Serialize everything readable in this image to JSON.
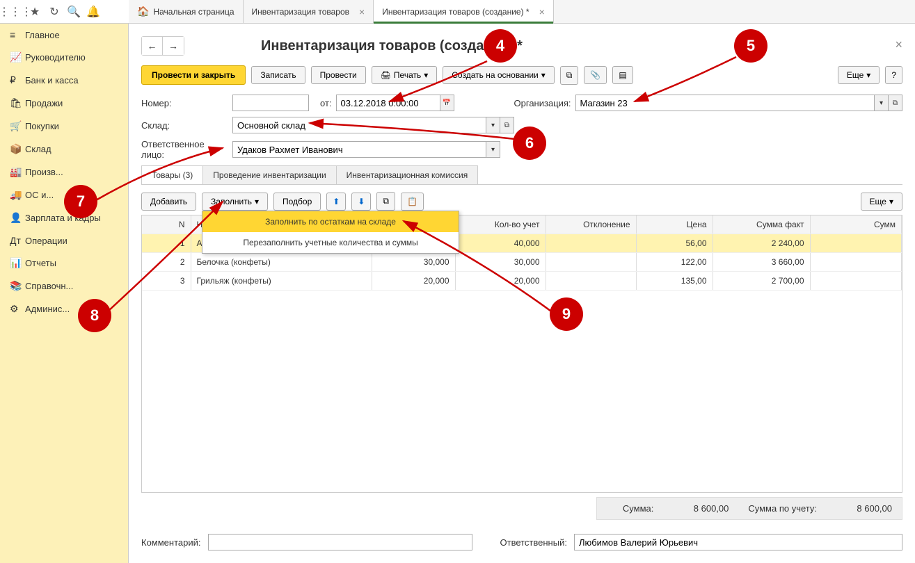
{
  "tabs": {
    "home": "Начальная страница",
    "t1": "Инвентаризация товаров",
    "t2": "Инвентаризация товаров (создание) *"
  },
  "sidebar": {
    "items": [
      {
        "icon": "≡",
        "label": "Главное"
      },
      {
        "icon": "📈",
        "label": "Руководителю"
      },
      {
        "icon": "₽",
        "label": "Банк и касса"
      },
      {
        "icon": "🛍",
        "label": "Продажи"
      },
      {
        "icon": "🛒",
        "label": "Покупки"
      },
      {
        "icon": "📦",
        "label": "Склад"
      },
      {
        "icon": "🏭",
        "label": "Произв..."
      },
      {
        "icon": "🚚",
        "label": "ОС и..."
      },
      {
        "icon": "👤",
        "label": "Зарплата и кадры"
      },
      {
        "icon": "Дт",
        "label": "Операции"
      },
      {
        "icon": "📊",
        "label": "Отчеты"
      },
      {
        "icon": "📚",
        "label": "Справочн..."
      },
      {
        "icon": "⚙",
        "label": "Админис..."
      }
    ]
  },
  "page": {
    "title": "Инвентаризация товаров (создание) *"
  },
  "toolbar": {
    "submit": "Провести и закрыть",
    "save": "Записать",
    "conduct": "Провести",
    "print": "Печать",
    "create_based": "Создать на основании",
    "more": "Еще"
  },
  "form": {
    "number_label": "Номер:",
    "from_label": "от:",
    "date_value": "03.12.2018 0:00:00",
    "org_label": "Организация:",
    "org_value": "Магазин 23",
    "warehouse_label": "Склад:",
    "warehouse_value": "Основной склад",
    "responsible_person_label": "Ответственное лицо:",
    "responsible_person_value": "Удаков Рахмет Иванович"
  },
  "subtabs": {
    "t1": "Товары (3)",
    "t2": "Проведение инвентаризации",
    "t3": "Инвентаризационная комиссия"
  },
  "table_toolbar": {
    "add": "Добавить",
    "fill": "Заполнить",
    "pick": "Подбор",
    "more": "Еще"
  },
  "dropdown": {
    "item1": "Заполнить по остаткам на складе",
    "item2": "Перезаполнить учетные количества и суммы"
  },
  "table": {
    "headers": {
      "n": "N",
      "name": "Н",
      "qty_fact": "",
      "qty_acc": "Кол-во учет",
      "deviation": "Отклонение",
      "price": "Цена",
      "sum_fact": "Сумма факт",
      "sum_acc": "Сумм"
    },
    "rows": [
      {
        "n": "1",
        "name": "А",
        "qty_fact": "",
        "qty_acc": "40,000",
        "dev": "",
        "price": "56,00",
        "sum_fact": "2 240,00"
      },
      {
        "n": "2",
        "name": "Белочка (конфеты)",
        "qty_fact": "30,000",
        "qty_acc": "30,000",
        "dev": "",
        "price": "122,00",
        "sum_fact": "3 660,00"
      },
      {
        "n": "3",
        "name": "Грильяж (конфеты)",
        "qty_fact": "20,000",
        "qty_acc": "20,000",
        "dev": "",
        "price": "135,00",
        "sum_fact": "2 700,00"
      }
    ]
  },
  "summary": {
    "sum_label": "Сумма:",
    "sum_value": "8 600,00",
    "sum_acc_label": "Сумма по учету:",
    "sum_acc_value": "8 600,00"
  },
  "footer": {
    "comment_label": "Комментарий:",
    "responsible_label": "Ответственный:",
    "responsible_value": "Любимов Валерий Юрьевич"
  },
  "callouts": {
    "c4": "4",
    "c5": "5",
    "c6": "6",
    "c7": "7",
    "c8": "8",
    "c9": "9"
  }
}
